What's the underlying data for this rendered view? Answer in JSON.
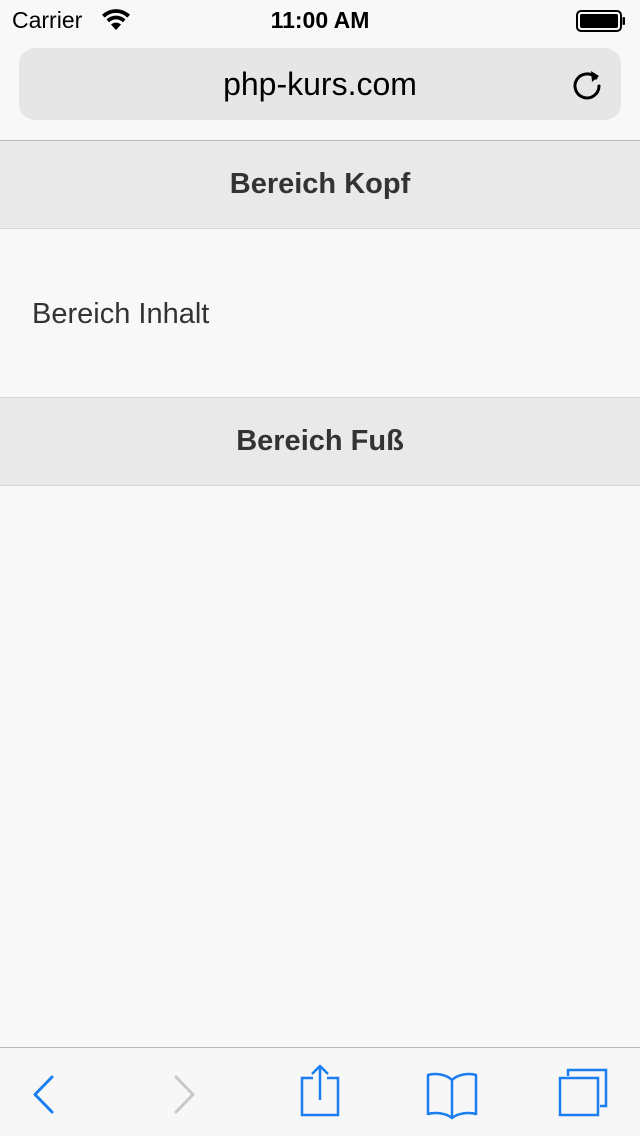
{
  "status_bar": {
    "carrier": "Carrier",
    "time": "11:00 AM",
    "wifi_icon": "wifi-icon",
    "battery_icon": "battery-icon"
  },
  "browser": {
    "url": "php-kurs.com",
    "reload_icon": "reload-icon"
  },
  "page": {
    "header": "Bereich Kopf",
    "content": "Bereich Inhalt",
    "footer": "Bereich Fuß"
  },
  "toolbar": {
    "items": [
      {
        "icon": "back-chevron-icon",
        "enabled": true
      },
      {
        "icon": "forward-chevron-icon",
        "enabled": false
      },
      {
        "icon": "share-icon",
        "enabled": true
      },
      {
        "icon": "bookmarks-book-icon",
        "enabled": true
      },
      {
        "icon": "tabs-icon",
        "enabled": true
      }
    ]
  },
  "colors": {
    "accent": "#1a7ef0",
    "disabled": "#c7c7cc",
    "section_bg": "#e9e9e9",
    "page_bg": "#f8f8f8",
    "text": "#333333"
  }
}
